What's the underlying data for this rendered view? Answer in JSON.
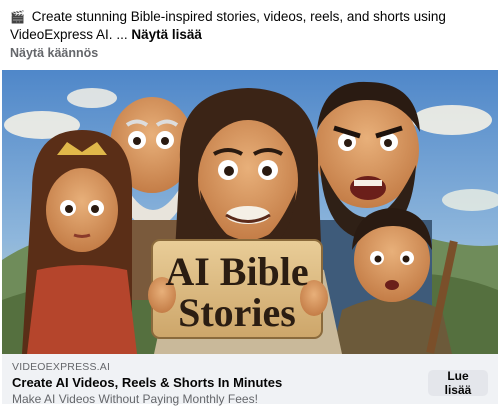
{
  "post": {
    "icon": "clapperboard-icon",
    "icon_glyph": "🎬",
    "text": "Create stunning Bible-inspired stories, videos, reels, and shorts using VideoExpress AI. ...",
    "see_more": "Näytä lisää",
    "translation_link": "Näytä käännös"
  },
  "ad_image": {
    "sign_line1": "AI Bible",
    "sign_line2": "Stories"
  },
  "link_card": {
    "domain": "VIDEOEXPRESS.AI",
    "headline": "Create AI Videos, Reels & Shorts In Minutes",
    "subline": "Make AI Videos Without Paying Monthly Fees!",
    "cta_label": "Lue lisää"
  },
  "colors": {
    "text_primary": "#050505",
    "text_secondary": "#65676b",
    "card_bg": "#f0f2f5",
    "button_bg": "#e4e6eb"
  }
}
